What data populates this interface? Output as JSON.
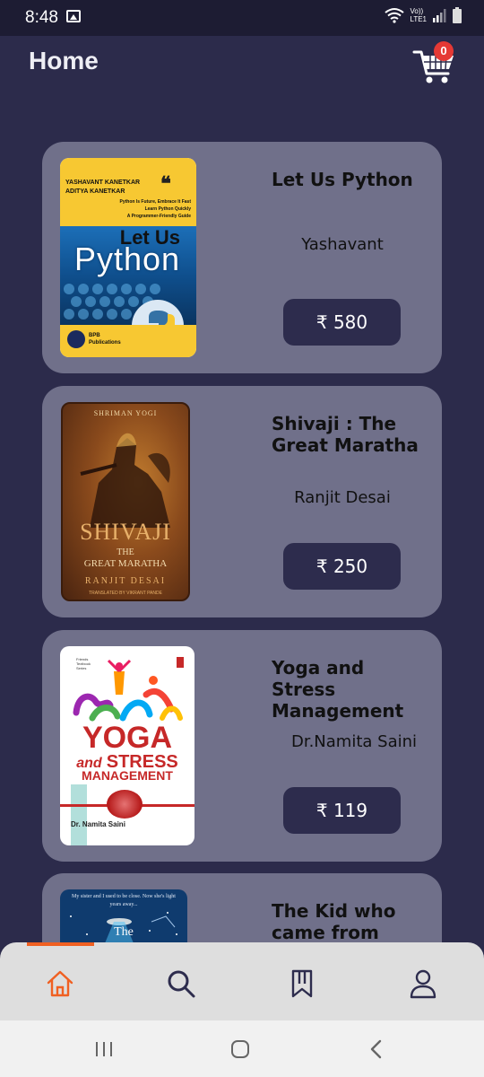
{
  "status_bar": {
    "time": "8:48",
    "network_top": "Vo))",
    "network_bottom": "LTE1"
  },
  "header": {
    "title": "Home",
    "cart_count": "0"
  },
  "colors": {
    "background": "#2c2b4b",
    "card": "#70708a",
    "button": "#2d2c4d",
    "accent": "#f06022",
    "badge": "#e53935"
  },
  "books": [
    {
      "title": "Let Us Python",
      "author": "Yashavant",
      "price": "₹ 580",
      "cover": {
        "author_line1": "YASHAVANT KANETKAR",
        "author_line2": "ADITYA KANETKAR",
        "tagline1": "Python Is Future, Embrace It Fast",
        "tagline2": "Learn Python Quickly",
        "tagline3": "A Programmer-Friendly Guide",
        "title_top": "Let Us",
        "title_main": "Python",
        "publisher": "BPB Publications"
      }
    },
    {
      "title": "Shivaji : The Great Maratha",
      "author": "Ranjit Desai",
      "price": "₹ 250",
      "cover": {
        "top": "SHRIMAN YOGI",
        "title_main": "SHIVAJI",
        "title_the": "THE",
        "subtitle": "GREAT MARATHA",
        "author": "RANJIT DESAI",
        "translator": "TRANSLATED BY VIKRANT PANDE"
      }
    },
    {
      "title": "Yoga and Stress Management",
      "author": "Dr.Namita Saini",
      "price": "₹ 119",
      "cover": {
        "series": "Friends Textbook Series",
        "title_main": "YOGA",
        "title_and": "and",
        "title_stress": "STRESS",
        "title_mgmt": "MANAGEMENT",
        "author": "Dr. Namita Saini"
      }
    },
    {
      "title": "The Kid who came from",
      "author": "",
      "price": "",
      "cover": {
        "tagline": "My sister and I used to be close. Now she's light years away...",
        "title_main": "The"
      }
    }
  ],
  "bottom_nav": {
    "items": [
      "home-icon",
      "search-icon",
      "bookmarks-icon",
      "profile-icon"
    ],
    "active": "home-icon"
  },
  "system_nav": {
    "items": [
      "recent-apps-icon",
      "home-circle-icon",
      "back-icon"
    ]
  }
}
